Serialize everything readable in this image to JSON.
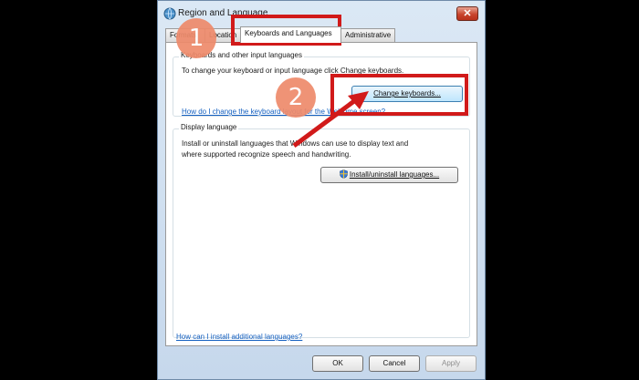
{
  "window": {
    "title": "Region and Language",
    "close_glyph": "✕"
  },
  "tabs": [
    {
      "label": "Formats"
    },
    {
      "label": "Location"
    },
    {
      "label": "Keyboards and Languages"
    },
    {
      "label": "Administrative"
    }
  ],
  "keyboards_group": {
    "label": "Keyboards and other input languages",
    "description": "To change your keyboard or input language click Change keyboards.",
    "button_label": "Change keyboards...",
    "help_link": "How do I change the keyboard layout for the Welcome screen?"
  },
  "display_group": {
    "label": "Display language",
    "description_line1": "Install or uninstall languages that Windows can use to display text and",
    "description_line2": "where supported recognize speech and handwriting.",
    "button_label": "Install/uninstall languages..."
  },
  "help_link_bottom": "How can I install additional languages?",
  "dialog_buttons": {
    "ok": "OK",
    "cancel": "Cancel",
    "apply": "Apply"
  },
  "annotations": {
    "step1": "1",
    "step2": "2",
    "highlight_color": "#d11a1a",
    "badge_color": "#ee8a6b"
  }
}
